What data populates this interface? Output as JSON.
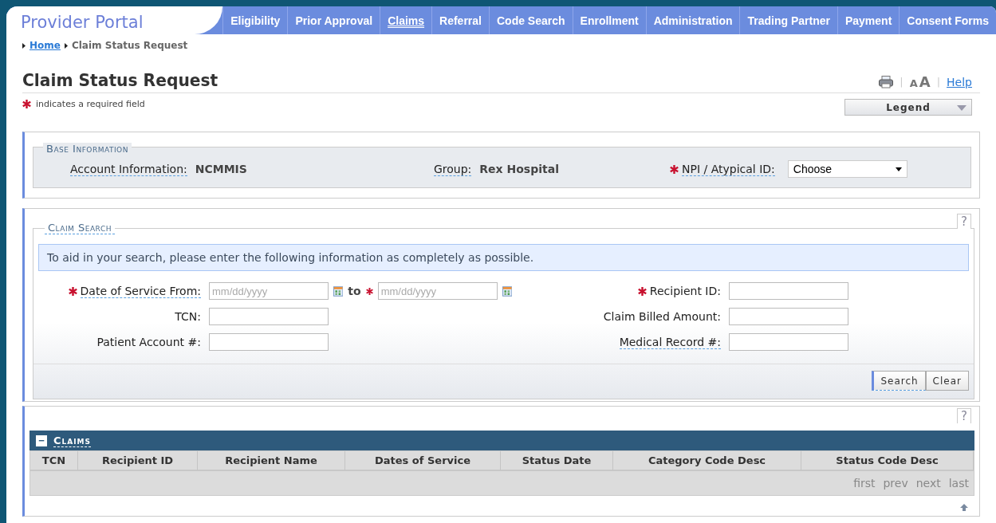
{
  "header": {
    "title": "Provider Portal"
  },
  "nav": [
    {
      "label": "Eligibility",
      "selected": false
    },
    {
      "label": "Prior Approval",
      "selected": false
    },
    {
      "label": "Claims",
      "selected": true
    },
    {
      "label": "Referral",
      "selected": false
    },
    {
      "label": "Code Search",
      "selected": false
    },
    {
      "label": "Enrollment",
      "selected": false
    },
    {
      "label": "Administration",
      "selected": false
    },
    {
      "label": "Trading Partner",
      "selected": false
    },
    {
      "label": "Payment",
      "selected": false
    },
    {
      "label": "Consent Forms",
      "selected": false
    }
  ],
  "breadcrumb": [
    {
      "label": "Home",
      "kind": "link"
    },
    {
      "label": "Claim Status Request",
      "kind": "current"
    }
  ],
  "page": {
    "title": "Claim Status Request",
    "required_note": "indicates a required field",
    "separators": [
      "|",
      "|"
    ],
    "text_size": [
      "A",
      "A"
    ],
    "help": "Help",
    "legend": "Legend"
  },
  "base_information": {
    "legend": "Base Information",
    "fields": [
      {
        "label": "Account Information:",
        "value": "NCMMIS",
        "tooltip": true
      },
      {
        "label": "Group:",
        "value": "Rex Hospital",
        "tooltip": true
      }
    ],
    "npi": {
      "label": "NPI / Atypical ID:",
      "required": true,
      "tooltip": true,
      "value": "Choose"
    }
  },
  "claim_search": {
    "legend": "Claim Search",
    "help": "?",
    "info": "To aid in your search, please enter the following information as completely as possible.",
    "left_fields": [
      {
        "kind": "date_range",
        "label": "Date of Service From:",
        "required": true,
        "tooltip": true,
        "placeholder": "mm/dd/yyyy",
        "to_label": "to",
        "to_required": true,
        "to_placeholder": "mm/dd/yyyy"
      },
      {
        "kind": "text",
        "label": "TCN:",
        "required": false,
        "tooltip": false
      },
      {
        "kind": "text",
        "label": "Patient Account #:",
        "required": false,
        "tooltip": false
      }
    ],
    "right_fields": [
      {
        "kind": "text",
        "label": "Recipient ID:",
        "required": true,
        "tooltip": false
      },
      {
        "kind": "text",
        "label": "Claim Billed Amount:",
        "required": false,
        "tooltip": false
      },
      {
        "kind": "text",
        "label": "Medical Record #:",
        "required": false,
        "tooltip": true
      }
    ],
    "buttons": [
      {
        "label": "Search",
        "focused": true
      },
      {
        "label": "Clear",
        "focused": false
      }
    ]
  },
  "claims": {
    "help": "?",
    "collapse": "−",
    "title": "Claims",
    "columns": [
      "TCN",
      "Recipient ID",
      "Recipient Name",
      "Dates of Service",
      "Status Date",
      "Category Code Desc",
      "Status Code Desc"
    ],
    "pager": [
      "first",
      "prev",
      "next",
      "last"
    ]
  }
}
